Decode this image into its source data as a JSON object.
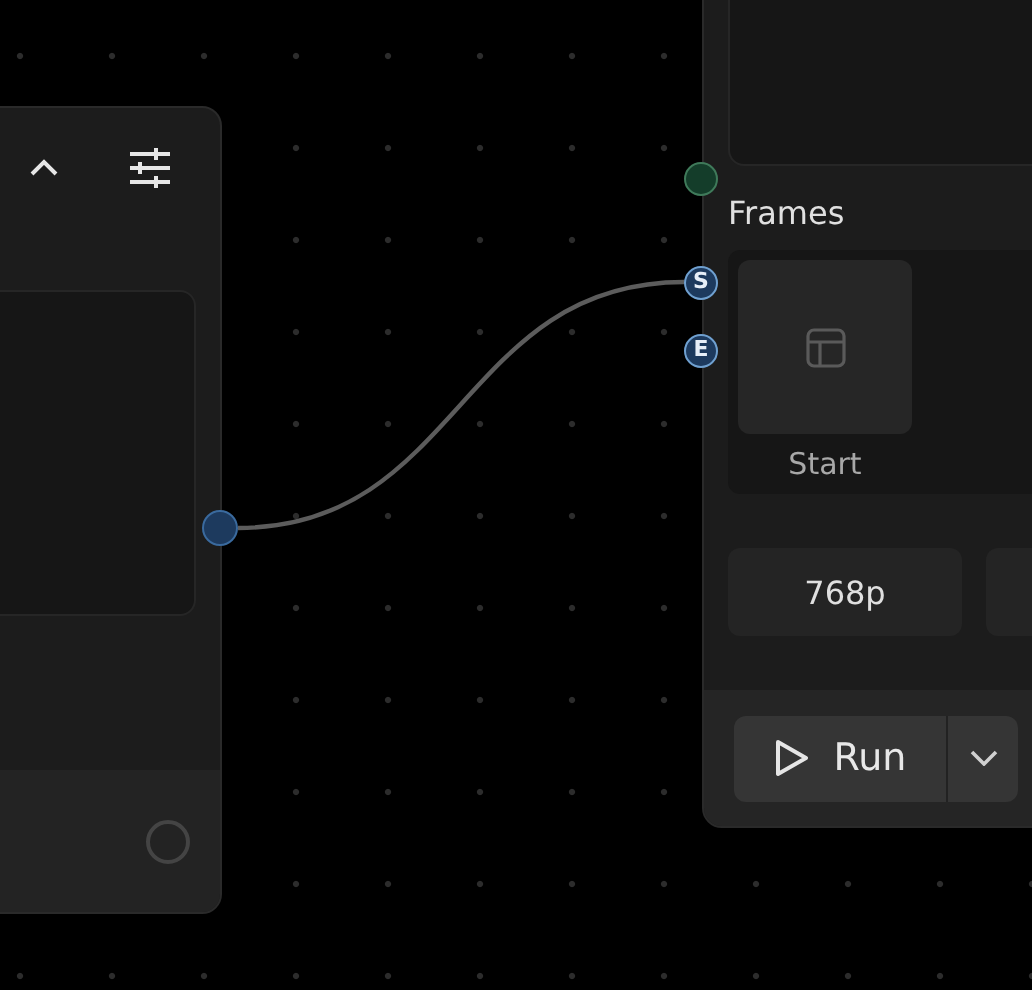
{
  "left_node": {
    "expanded": true
  },
  "right_node": {
    "section_label": "Frames",
    "frames": [
      {
        "label": "Start"
      }
    ],
    "handles": [
      {
        "label": "S"
      },
      {
        "label": "E"
      }
    ],
    "resolution": "768p",
    "run_button": {
      "label": "Run"
    }
  }
}
